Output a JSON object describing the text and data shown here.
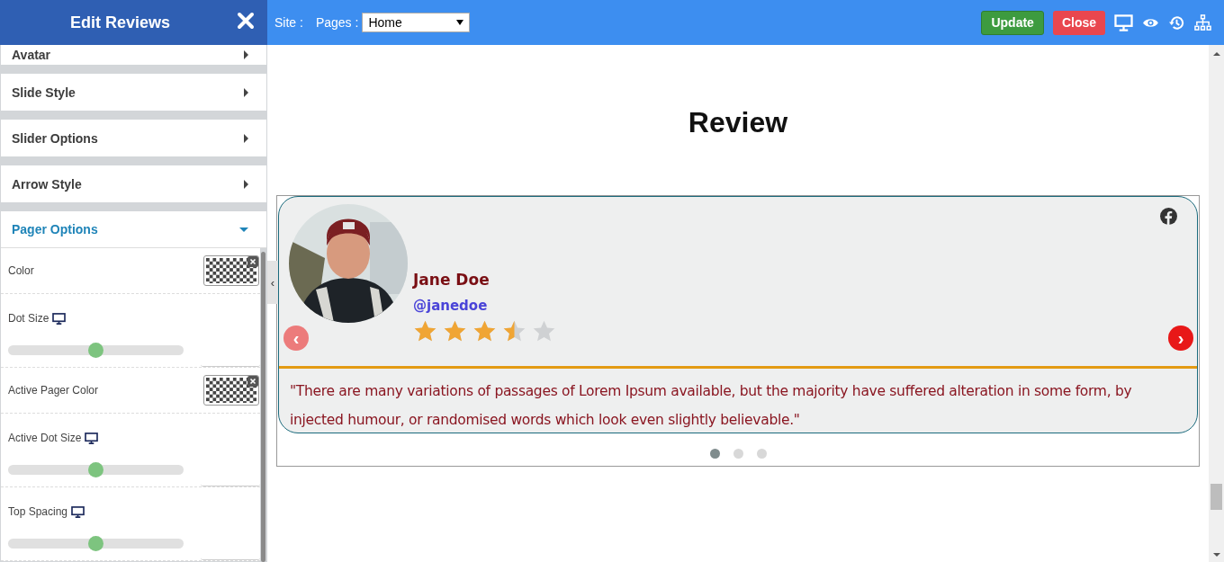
{
  "sidebar": {
    "title": "Edit Reviews",
    "sections": [
      {
        "label": "Avatar",
        "expanded": false
      },
      {
        "label": "Slide Style",
        "expanded": false
      },
      {
        "label": "Slider Options",
        "expanded": false
      },
      {
        "label": "Arrow Style",
        "expanded": false
      },
      {
        "label": "Pager Options",
        "expanded": true
      }
    ],
    "settings": [
      {
        "kind": "color",
        "label": "Color"
      },
      {
        "kind": "slider",
        "label": "Dot Size",
        "level": 0.5
      },
      {
        "kind": "color",
        "label": "Active Pager Color"
      },
      {
        "kind": "slider",
        "label": "Active Dot Size",
        "level": 0.5
      },
      {
        "kind": "slider",
        "label": "Top Spacing",
        "level": 0.5
      }
    ],
    "collapse_handle": "‹"
  },
  "toolbar": {
    "site_label": "Site :",
    "pages_label": "Pages :",
    "page_value": "Home",
    "buttons": [
      {
        "label": "Update",
        "kind": "update"
      },
      {
        "label": "Close",
        "kind": "close"
      }
    ]
  },
  "page": {
    "heading": "Review",
    "review": {
      "name": "Jane Doe",
      "handle": "@janedoe",
      "stars": 3.5,
      "quote": "\"There are many variations of passages of Lorem Ipsum available, but the majority have suffered alteration in some form, by injected humour, or randomised words which look even slightly believable.\""
    },
    "prev_arrow": "‹",
    "next_arrow": "›",
    "pager": [
      {
        "selected": true
      },
      {
        "selected": false
      },
      {
        "selected": false
      }
    ]
  }
}
